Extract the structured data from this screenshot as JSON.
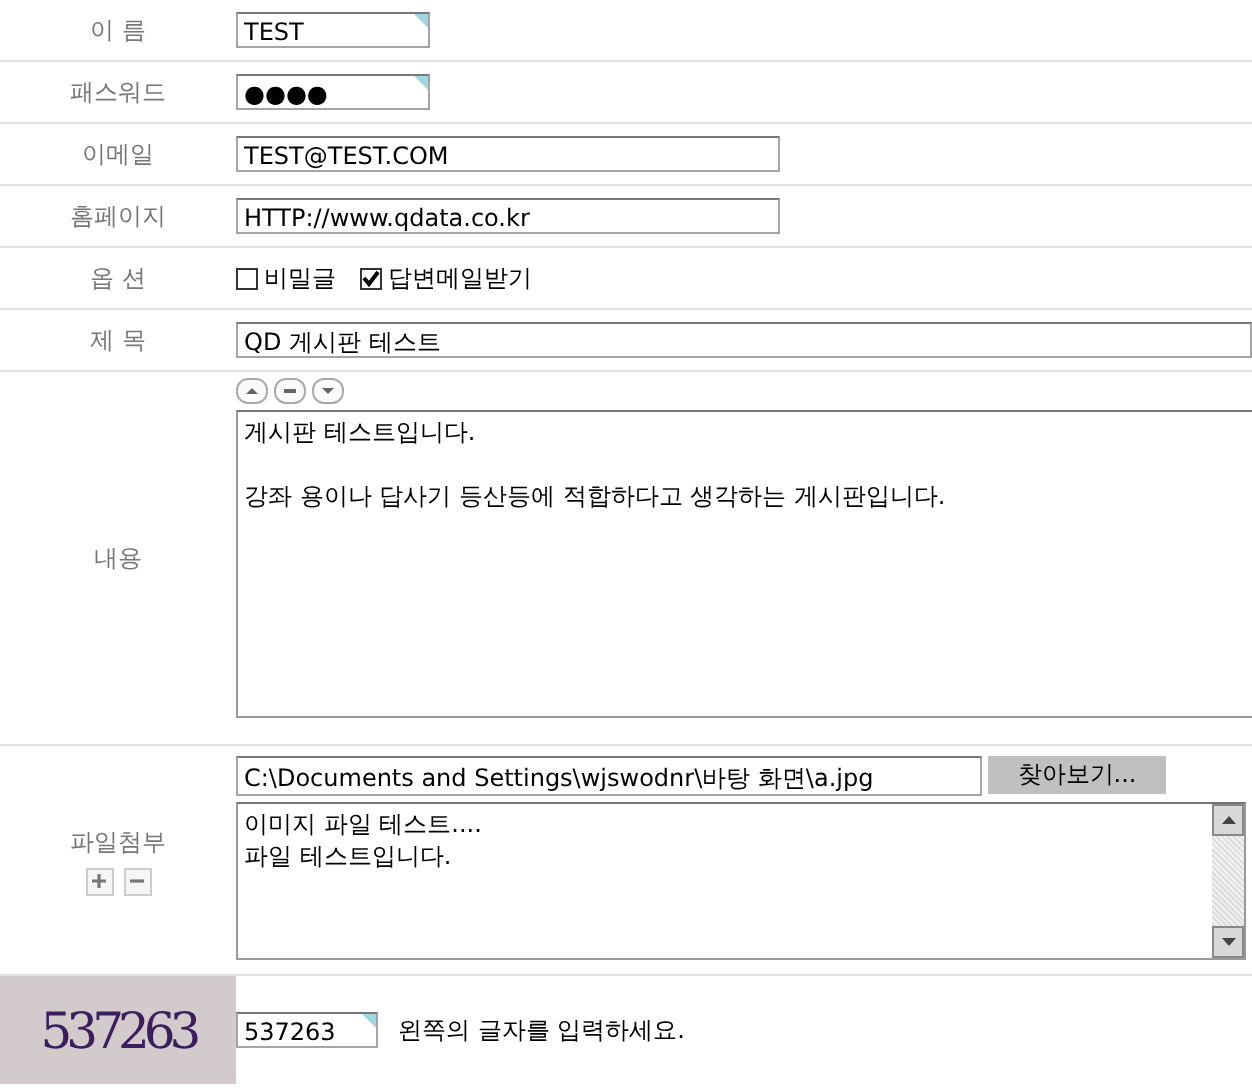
{
  "rows": [
    {
      "kind": "short_field",
      "label": "이 름",
      "value": "TEST"
    },
    {
      "kind": "short_field",
      "label": "패스워드",
      "value": "●●●●"
    },
    {
      "kind": "field",
      "label": "이메일",
      "value": "TEST@TEST.COM"
    },
    {
      "kind": "field",
      "label": "홈페이지",
      "value": "HTTP://www.qdata.co.kr"
    },
    {
      "kind": "options",
      "label": "옵 션",
      "options": [
        {
          "label": "비밀글",
          "checked": false
        },
        {
          "label": "답변메일받기",
          "checked": true
        }
      ]
    },
    {
      "kind": "wide_field",
      "label": "제 목",
      "value": "QD 게시판 테스트"
    },
    {
      "kind": "editor",
      "label": "내용",
      "paragraphs": [
        "게시판 테스트입니다.",
        "강좌 용이나 답사기 등산등에 적합하다고 생각하는 게시판입니다."
      ]
    },
    {
      "kind": "attachment",
      "label": "파일첨부",
      "path": "C:\\Documents and Settings\\wjswodnr\\바탕 화면\\a.jpg",
      "browse": "찾아보기...",
      "lines": [
        "이미지 파일 테스트....",
        "파일 테스트입니다."
      ]
    },
    {
      "kind": "captcha",
      "code": "537263",
      "value": "537263",
      "hint": "왼쪽의 글자를 입력하세요."
    }
  ]
}
